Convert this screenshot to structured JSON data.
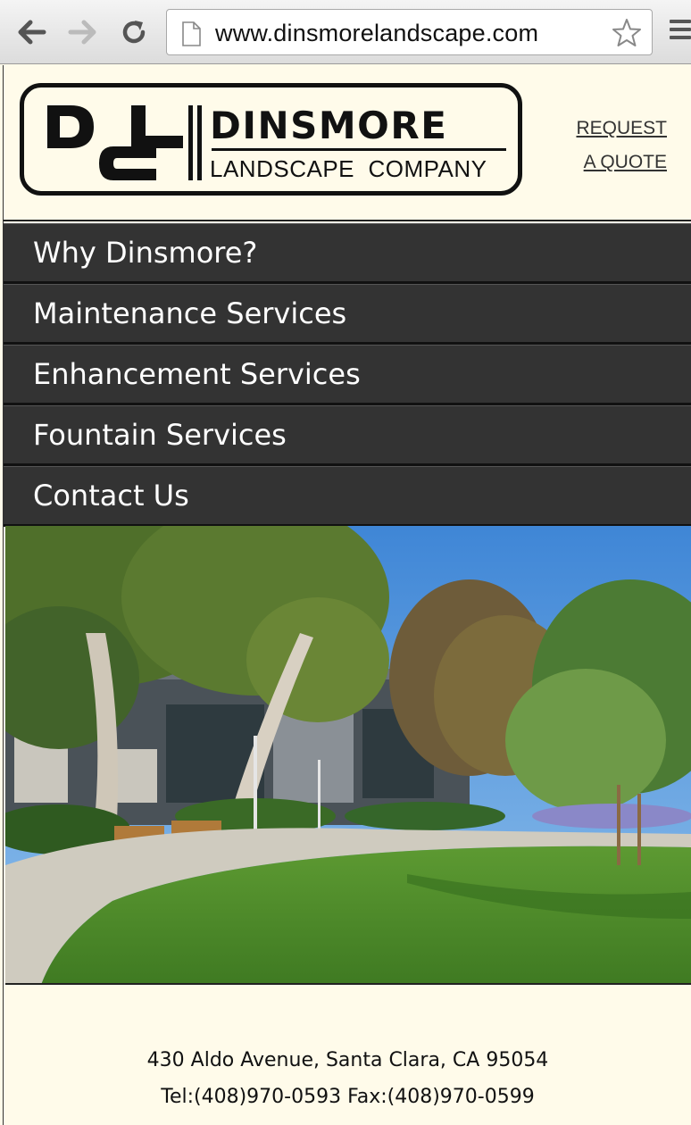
{
  "browser": {
    "url": "www.dinsmorelandscape.com",
    "icons": [
      "back-arrow-icon",
      "forward-arrow-icon",
      "reload-icon",
      "page-icon",
      "star-icon",
      "menu-icon"
    ]
  },
  "header": {
    "logo": {
      "monogram": "DLC",
      "name": "DINSMORE",
      "subtitle": "LANDSCAPE  COMPANY"
    },
    "quote_link": {
      "line1": "REQUEST",
      "line2": "A QUOTE"
    }
  },
  "nav": {
    "items": [
      {
        "label": "Why Dinsmore?"
      },
      {
        "label": "Maintenance Services"
      },
      {
        "label": "Enhancement Services"
      },
      {
        "label": "Fountain Services"
      },
      {
        "label": "Contact Us"
      }
    ]
  },
  "footer": {
    "address": "430 Aldo Avenue, Santa Clara, CA 95054",
    "phone": "Tel:(408)970-0593 Fax:(408)970-0599"
  },
  "colors": {
    "page_background": "#fffbea",
    "nav_background": "#333333",
    "nav_text": "#ffffff",
    "sky": "#5a9ee0",
    "lawn": "#4e8a2c"
  }
}
